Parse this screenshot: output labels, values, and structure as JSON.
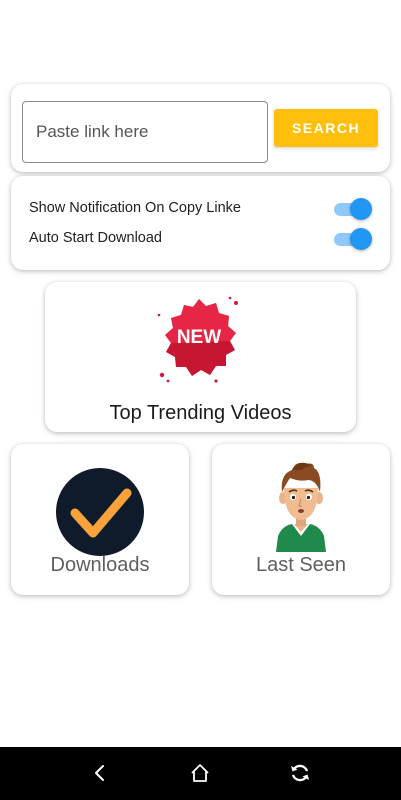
{
  "search": {
    "placeholder": "Paste link here",
    "value": "",
    "button_label": "SEARCH"
  },
  "settings": {
    "items": [
      {
        "label": "Show Notification On Copy Linke",
        "enabled": true
      },
      {
        "label": "Auto Start Download",
        "enabled": true
      }
    ]
  },
  "trending": {
    "badge_text": "NEW",
    "label": "Top Trending Videos"
  },
  "downloads": {
    "label": "Downloads"
  },
  "last_seen": {
    "label": "Last Seen"
  },
  "nav": {
    "back_icon": "back-icon",
    "home_icon": "home-icon",
    "recent_icon": "refresh-icon"
  },
  "colors": {
    "accent": "#ffbf0a",
    "toggle_on": "#2196f3",
    "badge_red": "#d81838",
    "check_orange": "#f7a23a",
    "check_bg": "#0f1b2a"
  }
}
